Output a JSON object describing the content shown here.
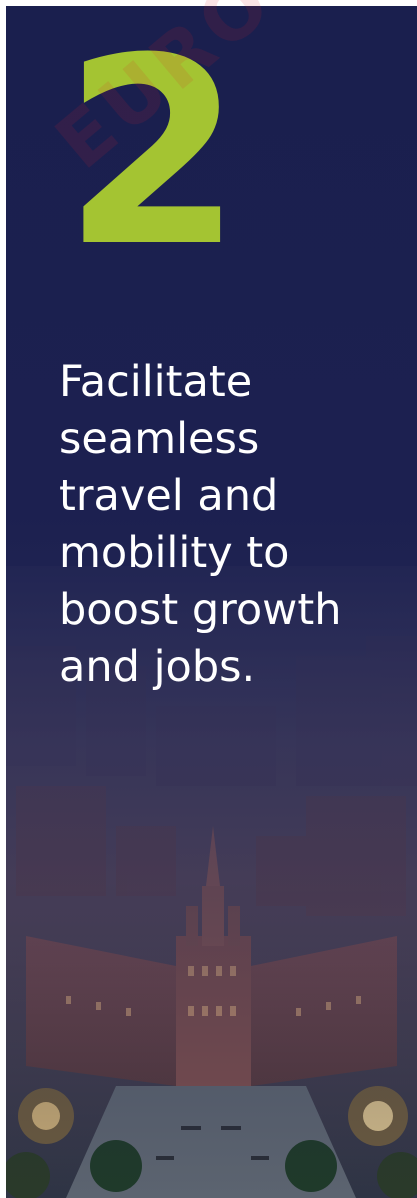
{
  "banner": {
    "number": "2",
    "headline": "Facilitate\nseamless\ntravel and\nmobility to\nboost growth\nand jobs.",
    "number_color": "#a4c432",
    "background_color": "#1a1f4e"
  },
  "photo": {
    "subject": "aerial-city-hospital-complex"
  },
  "watermark": {
    "text": "EURO"
  }
}
